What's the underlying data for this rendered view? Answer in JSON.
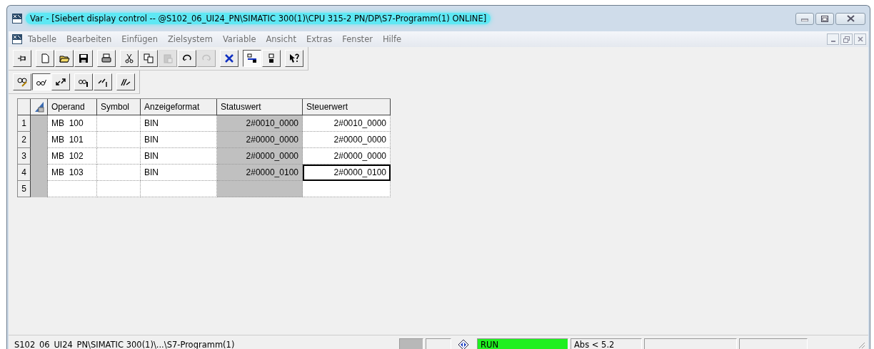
{
  "window": {
    "title": "Var - [Siebert display control -- @S102_06_UI24_PN\\SIMATIC 300(1)\\CPU 315-2 PN/DP\\S7-Programm(1)  ONLINE]"
  },
  "menu": [
    "Tabelle",
    "Bearbeiten",
    "Einfügen",
    "Zielsystem",
    "Variable",
    "Ansicht",
    "Extras",
    "Fenster",
    "Hilfe"
  ],
  "toolbar": [
    [
      {
        "pressed": false,
        "disabled": false
      }
    ],
    [
      {
        "pressed": false,
        "disabled": false
      },
      {
        "pressed": false,
        "disabled": false
      },
      {
        "pressed": false,
        "disabled": false
      }
    ],
    [
      {
        "pressed": false,
        "disabled": false
      }
    ],
    [
      {
        "pressed": false,
        "disabled": false
      },
      {
        "pressed": false,
        "disabled": false
      },
      {
        "pressed": false,
        "disabled": true
      },
      {
        "pressed": false,
        "disabled": false
      },
      {
        "pressed": false,
        "disabled": true
      }
    ],
    [
      {
        "pressed": false,
        "disabled": false
      }
    ],
    [
      {
        "pressed": true,
        "disabled": false
      },
      {
        "pressed": false,
        "disabled": false
      }
    ],
    [
      {
        "pressed": false,
        "disabled": false
      }
    ]
  ],
  "toolbar_2": [
    [
      {
        "pressed": false,
        "disabled": false
      },
      {
        "pressed": true,
        "disabled": false
      },
      {
        "pressed": false,
        "disabled": false
      }
    ],
    [
      {
        "pressed": false,
        "disabled": false
      },
      {
        "pressed": false,
        "disabled": false
      }
    ],
    [
      {
        "pressed": false,
        "disabled": false
      }
    ]
  ],
  "table": {
    "columns": [
      "Operand",
      "Symbol",
      "Anzeigeformat",
      "Statuswert",
      "Steuerwert"
    ],
    "rows": [
      {
        "number": "1",
        "operand": "MB  100",
        "format": "BIN",
        "status": "2#0010_0000",
        "control": "2#0010_0000",
        "focused": false
      },
      {
        "number": "2",
        "operand": "MB  101",
        "format": "BIN",
        "status": "2#0000_0000",
        "control": "2#0000_0000",
        "focused": false
      },
      {
        "number": "3",
        "operand": "MB  102",
        "format": "BIN",
        "status": "2#0000_0000",
        "control": "2#0000_0000",
        "focused": false
      },
      {
        "number": "4",
        "operand": "MB  103",
        "format": "BIN",
        "status": "2#0000_0100",
        "control": "2#0000_0100",
        "focused": true
      },
      {
        "number": "5",
        "focused": false
      }
    ]
  },
  "status_bar": {
    "path": "S102_06_UI24_PN\\SIMATIC 300(1)\\...\\S7-Programm(1)",
    "mode": "RUN",
    "running": true,
    "info": "Abs < 5.2"
  }
}
